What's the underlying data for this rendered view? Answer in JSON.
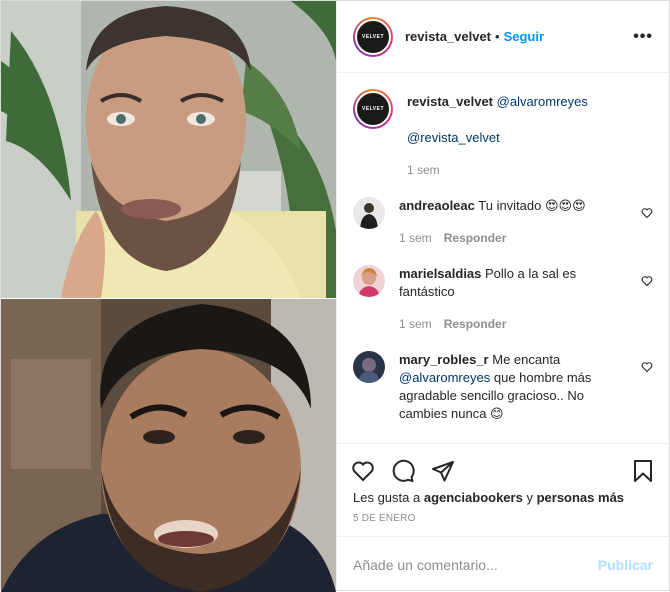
{
  "header": {
    "username": "revista_velvet",
    "separator": "•",
    "follow_label": "Seguir",
    "more_icon": "more-horizontal-icon",
    "avatar_text": "VELVET"
  },
  "caption": {
    "username": "revista_velvet",
    "mention_1": "@alvaromreyes",
    "mention_2": "@revista_velvet",
    "time": "1 sem"
  },
  "comments": [
    {
      "username": "andreaoleac",
      "text": "Tu invitado 😍😍😍",
      "time": "1 sem",
      "reply_label": "Responder"
    },
    {
      "username": "marielsaldias",
      "text": "Pollo a la sal es fantástico",
      "time": "1 sem",
      "reply_label": "Responder"
    },
    {
      "username": "mary_robles_r",
      "text_before": "Me encanta",
      "mention": "@alvaromreyes",
      "text_after": "que hombre más agradable sencillo gracioso.. No cambies nunca 😊"
    }
  ],
  "actions": {
    "like_icon": "heart-icon",
    "comment_icon": "comment-icon",
    "share_icon": "paper-plane-icon",
    "save_icon": "bookmark-icon"
  },
  "likes": {
    "prefix": "Les gusta a",
    "user": "agenciabookers",
    "conjunction": "y",
    "others": "personas más"
  },
  "date": "5 DE ENERO",
  "add_comment": {
    "placeholder": "Añade un comentario...",
    "publish_label": "Publicar"
  },
  "colors": {
    "accent": "#0095f6",
    "publish_disabled": "#b2dffc",
    "mention": "#00376b",
    "muted": "#8e8e8e"
  }
}
